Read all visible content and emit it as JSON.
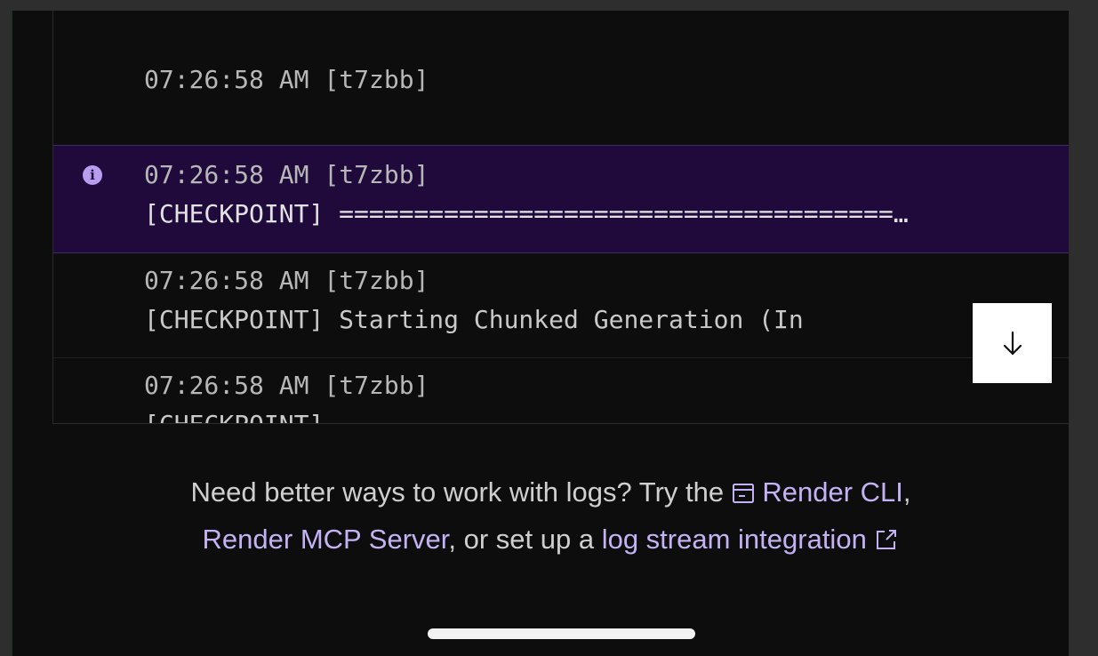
{
  "logs": [
    {
      "timestamp": "07:26:58 AM",
      "instance": "[t7zbb]",
      "message": ""
    },
    {
      "timestamp": "07:26:58 AM",
      "instance": "[t7zbb]",
      "message": "[CHECKPOINT] =====================================…",
      "level": "info-icon"
    },
    {
      "timestamp": "07:26:58 AM",
      "instance": "[t7zbb]",
      "message": "[CHECKPOINT] Starting Chunked Generation (In"
    },
    {
      "timestamp": "07:26:58 AM",
      "instance": "[t7zbb]",
      "message": "[CHECKPOINT]"
    }
  ],
  "scroll_button": {
    "icon": "arrow-down-icon"
  },
  "hint": {
    "prefix": "Need better ways to work with logs? Try the ",
    "cli_icon": "terminal-window-icon",
    "cli_link": "Render CLI",
    "sep1": ",",
    "mcp_link": "Render MCP Server",
    "sep2": ", or set up a ",
    "stream_link": "log stream integration",
    "external_icon": "external-link-icon"
  },
  "colors": {
    "background": "#0d0d0d",
    "highlight_row": "#1f0a3b",
    "accent_link": "#c4b2f4",
    "info_icon": "#b79cf0"
  }
}
